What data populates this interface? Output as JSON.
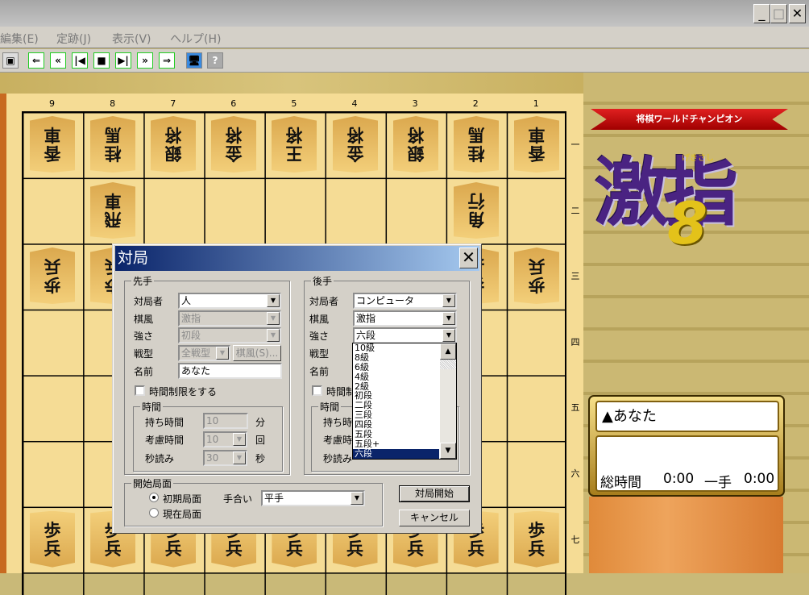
{
  "window": {
    "minimize": "_",
    "maximize": "□",
    "close": "✕"
  },
  "menu": [
    {
      "label": "編集(E)"
    },
    {
      "label": "定跡(J)"
    },
    {
      "label": "表示(V)"
    },
    {
      "label": "ヘルプ(H)"
    }
  ],
  "toolbar": {
    "icons": [
      "save-icon",
      "rewind-all-icon",
      "back-fast-icon",
      "back-step-icon",
      "stop-icon",
      "forward-step-icon",
      "forward-fast-icon",
      "forward-all-icon",
      "computer-icon",
      "help-icon"
    ],
    "glyphs": [
      "▣",
      "⇐",
      "«",
      "|◀",
      "■",
      "▶|",
      "»",
      "⇒",
      "🖥",
      "?"
    ]
  },
  "board": {
    "cols": [
      "9",
      "8",
      "7",
      "6",
      "5",
      "4",
      "3",
      "2",
      "1"
    ],
    "rows": [
      "一",
      "二",
      "三",
      "四",
      "五",
      "六",
      "七"
    ],
    "pieces": [
      {
        "c": 0,
        "r": 0,
        "t": "香車",
        "g": true
      },
      {
        "c": 1,
        "r": 0,
        "t": "桂馬",
        "g": true
      },
      {
        "c": 2,
        "r": 0,
        "t": "銀将",
        "g": true
      },
      {
        "c": 3,
        "r": 0,
        "t": "金将",
        "g": true
      },
      {
        "c": 4,
        "r": 0,
        "t": "王将",
        "g": true
      },
      {
        "c": 5,
        "r": 0,
        "t": "金将",
        "g": true
      },
      {
        "c": 6,
        "r": 0,
        "t": "銀将",
        "g": true
      },
      {
        "c": 7,
        "r": 0,
        "t": "桂馬",
        "g": true
      },
      {
        "c": 8,
        "r": 0,
        "t": "香車",
        "g": true
      },
      {
        "c": 1,
        "r": 1,
        "t": "飛車",
        "g": true
      },
      {
        "c": 7,
        "r": 1,
        "t": "角行",
        "g": true
      },
      {
        "c": 0,
        "r": 2,
        "t": "歩兵",
        "g": true
      },
      {
        "c": 1,
        "r": 2,
        "t": "歩兵",
        "g": true
      },
      {
        "c": 7,
        "r": 2,
        "t": "歩兵",
        "g": true
      },
      {
        "c": 8,
        "r": 2,
        "t": "歩兵",
        "g": true
      },
      {
        "c": 0,
        "r": 6,
        "t": "歩兵",
        "g": false
      },
      {
        "c": 1,
        "r": 6,
        "t": "歩兵",
        "g": false
      },
      {
        "c": 2,
        "r": 6,
        "t": "歩兵",
        "g": false
      },
      {
        "c": 3,
        "r": 6,
        "t": "歩兵",
        "g": false
      },
      {
        "c": 4,
        "r": 6,
        "t": "歩兵",
        "g": false
      },
      {
        "c": 5,
        "r": 6,
        "t": "歩兵",
        "g": false
      },
      {
        "c": 6,
        "r": 6,
        "t": "歩兵",
        "g": false
      },
      {
        "c": 7,
        "r": 6,
        "t": "歩兵",
        "g": false
      },
      {
        "c": 8,
        "r": 6,
        "t": "歩兵",
        "g": false
      }
    ]
  },
  "logo": {
    "ribbon": "将棋ワールドチャンピオン",
    "title": "激指",
    "number": "8",
    "ruby": "げきさし"
  },
  "player": {
    "name": "▲あなた",
    "total_label": "総時間",
    "total": "0:00",
    "move_label": "一手",
    "move": "0:00"
  },
  "dialog": {
    "title": "対局",
    "close": "✕",
    "sente": {
      "group": "先手",
      "player_label": "対局者",
      "player": "人",
      "style_label": "棋風",
      "style": "激指",
      "strength_label": "強さ",
      "strength": "初段",
      "tactic_label": "戦型",
      "tactic": "全戦型",
      "style_button": "棋風(S)...",
      "name_label": "名前",
      "name": "あなた"
    },
    "gote": {
      "group": "後手",
      "player_label": "対局者",
      "player": "コンピュータ",
      "style_label": "棋風",
      "style": "激指",
      "strength_label": "強さ",
      "strength": "六段",
      "tactic_label": "戦型",
      "name_label": "名前"
    },
    "time_limit_label": "時間制限をする",
    "gote_time_limit_label": "時間制",
    "time": {
      "group": "時間",
      "hold_label": "持ち時間",
      "hold": "10",
      "hold_unit": "分",
      "think_label": "考慮時間",
      "think": "10",
      "think_unit": "回",
      "byoyomi_label": "秒読み",
      "byoyomi": "30",
      "byoyomi_unit": "秒"
    },
    "gote_time": {
      "group": "時間",
      "hold_label": "持ち時",
      "think_label": "考慮時",
      "byoyomi_label": "秒読み"
    },
    "strength_options": [
      "10級",
      "8級",
      "6級",
      "4級",
      "2級",
      "初段",
      "二段",
      "三段",
      "四段",
      "五段",
      "五段+",
      "六段"
    ],
    "strength_selected": "六段",
    "start": {
      "group": "開始局面",
      "initial": "初期局面",
      "current": "現在局面",
      "handicap_label": "手合い",
      "handicap": "平手"
    },
    "start_button": "対局開始",
    "cancel_button": "キャンセル"
  }
}
